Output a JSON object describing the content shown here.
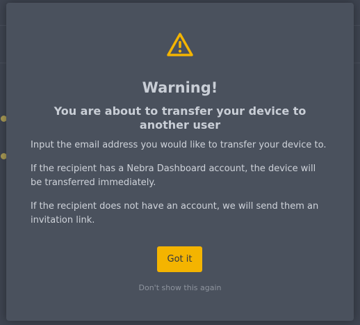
{
  "modal": {
    "icon": "warning-triangle-icon",
    "title": "Warning!",
    "subtitle": "You are about to transfer your device to another user",
    "paragraphs": [
      "Input the email address you would like to transfer your device to.",
      "If the recipient has a Nebra Dashboard account, the device will be transferred immediately.",
      "If the recipient does not have an account, we will send them an invitation link."
    ],
    "confirm_label": "Got it",
    "dismiss_label": "Don't show this again"
  },
  "colors": {
    "accent": "#f4b400",
    "modal_bg": "#4a515d",
    "backdrop": "#3e4450",
    "text": "#cfd3da",
    "muted": "#8e949e"
  }
}
